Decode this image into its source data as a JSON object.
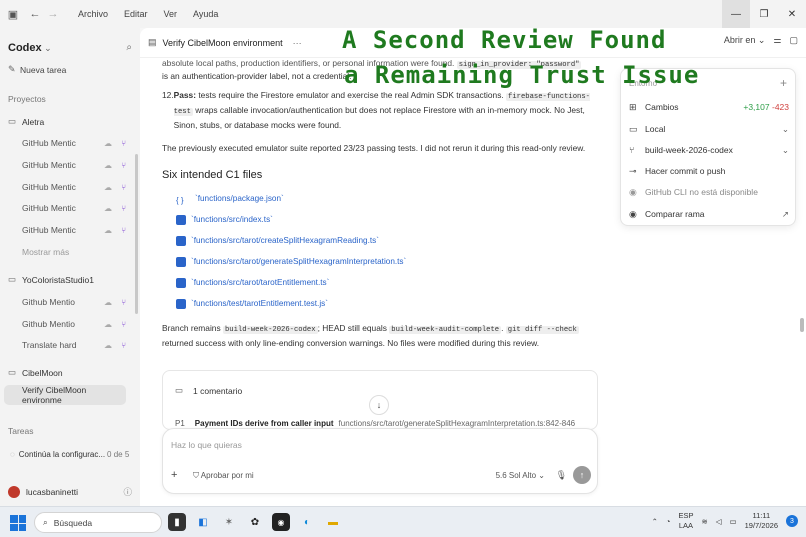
{
  "window": {
    "menu": [
      "Archivo",
      "Editar",
      "Ver",
      "Ayuda"
    ],
    "controls": [
      "minimize",
      "restore",
      "close"
    ]
  },
  "sidebar": {
    "brand": "Codex",
    "new_task": "Nueva tarea",
    "projects_label": "Proyectos",
    "groups": [
      {
        "name": "Aletra",
        "items": [
          "GitHub Mentic",
          "GitHub Mentic",
          "GitHub Mentic",
          "GitHub Mentic",
          "GitHub Mentic"
        ],
        "show_more": "Mostrar más"
      },
      {
        "name": "YoColoristaStudio1",
        "items": [
          "Github Mentio",
          "Github Mentio",
          "Translate hard"
        ]
      },
      {
        "name": "CibelMoon",
        "items": [
          "Verify CibelMoon environme"
        ]
      }
    ],
    "tasks_label": "Tareas",
    "task": {
      "label": "Continúa la configurac...",
      "progress": "0 de 5"
    },
    "user": "lucasbaninetti"
  },
  "main": {
    "thread_title": "Verify CibelMoon environment",
    "open_in": "Abrir en",
    "content": {
      "line1": "absolute local paths, production identifiers, or personal information were found.",
      "line1_code1": "sign_in_provider: \"password\"",
      "line2": "is an authentication-provider label, not a credential.",
      "item12_num": "12.",
      "item12_bold": "Pass:",
      "item12_text1": "tests require the Firestore emulator and exercise the real Admin SDK transactions.",
      "item12_code1": "firebase-functions-test",
      "item12_text2": "wraps callable invocation/authentication but does not replace Firestore with an in-memory mock. No Jest, Sinon, stubs, or database mocks were found.",
      "emulator_note": "The previously executed emulator suite reported 23/23 passing tests. I did not rerun it during this read-only review.",
      "files_heading": "Six intended C1 files",
      "files": [
        "`functions/package.json`",
        "`functions/src/index.ts`",
        "`functions/src/tarot/createSplitHexagramReading.ts`",
        "`functions/src/tarot/generateSplitHexagramInterpretation.ts`",
        "`functions/src/tarot/tarotEntitlement.ts`",
        "`functions/test/tarotEntitlement.test.js`"
      ],
      "branch_text1": "Branch remains",
      "branch_code": "build-week-2026-codex",
      "branch_text2": "; HEAD still equals",
      "head_code": "build-week-audit-complete",
      "branch_text3": ".",
      "diff_code": "git diff --check",
      "branch_text4": "returned success with only line-ending conversion warnings. No files were modified during this review."
    },
    "comment": {
      "count_label": "1 comentario",
      "priority": "P1",
      "title": "Payment IDs derive from caller input",
      "location": "functions/src/tarot/generateSplitHexagramInterpretation.ts:842-846"
    },
    "composer": {
      "placeholder": "Haz lo que quieras",
      "approve": "Aprobar por mi",
      "model": "5.6 Sol",
      "effort": "Alto"
    }
  },
  "overlay": {
    "line1": "A Second Review Found",
    "line2": "a Remaining Trust Issue"
  },
  "panel": {
    "label": "Entorno",
    "changes_label": "Cambios",
    "additions": "+3,107",
    "deletions": "-423",
    "location": "Local",
    "branch": "build-week-2026-codex",
    "commit_push": "Hacer commit o push",
    "gh_cli": "GitHub CLI no está disponible",
    "compare": "Comparar rama"
  },
  "taskbar": {
    "search": "Búsqueda",
    "lang1": "ESP",
    "lang2": "LAA",
    "time": "11:11",
    "date": "19/7/2026",
    "notifications": "3"
  },
  "colors": {
    "accent": "#2a64c9",
    "overlay_text": "#1f7a1f",
    "additions": "#2e9e48",
    "deletions": "#d0413f"
  }
}
